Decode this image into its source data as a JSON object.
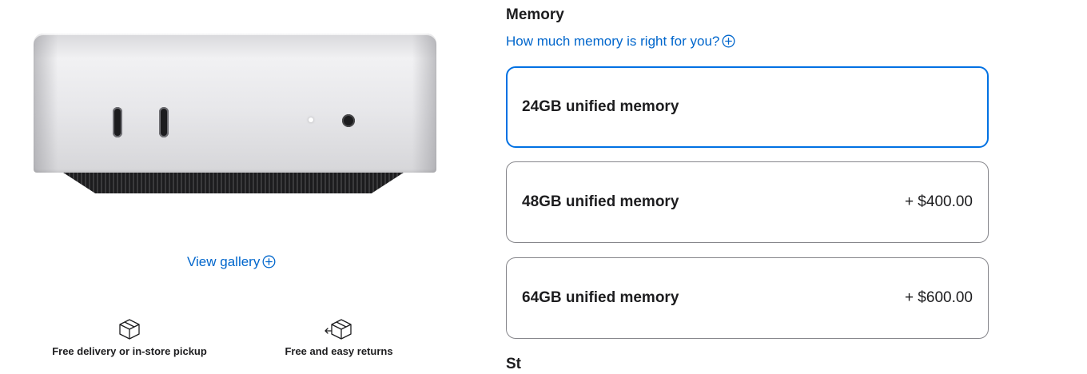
{
  "gallery": {
    "view_gallery_label": "View gallery",
    "icon": "plus-circle-icon"
  },
  "services": [
    {
      "label": "Free delivery or in-store pickup",
      "icon": "box-icon"
    },
    {
      "label": "Free and easy returns",
      "icon": "box-return-icon"
    }
  ],
  "memory": {
    "title": "Memory",
    "help_link": "How much memory is right for you?",
    "help_icon": "plus-circle-icon",
    "options": [
      {
        "label": "24GB unified memory",
        "price": "",
        "selected": true
      },
      {
        "label": "48GB unified memory",
        "price": "+ $400.00",
        "selected": false
      },
      {
        "label": "64GB unified memory",
        "price": "+ $600.00",
        "selected": false
      }
    ]
  },
  "next_section": {
    "title": "St"
  },
  "colors": {
    "link": "#0066cc",
    "selected_border": "#0071e3",
    "border": "#86868b",
    "text": "#1d1d1f"
  }
}
